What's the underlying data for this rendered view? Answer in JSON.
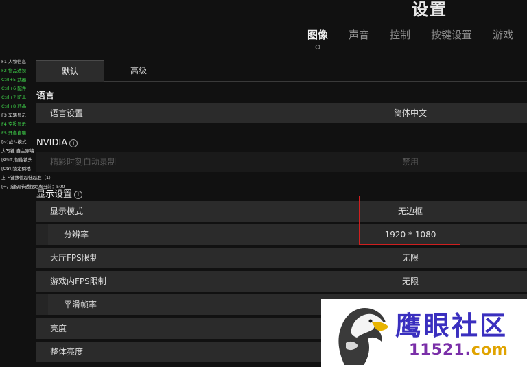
{
  "header": {
    "title": "设置",
    "tabs": [
      {
        "label": "图像",
        "active": true
      },
      {
        "label": "声音",
        "active": false
      },
      {
        "label": "控制",
        "active": false
      },
      {
        "label": "按键设置",
        "active": false
      },
      {
        "label": "游戏",
        "active": false
      }
    ]
  },
  "hotkeys": [
    {
      "text": "F1 人物信息",
      "color": "white"
    },
    {
      "text": "F2 物品透视",
      "color": "green"
    },
    {
      "text": "Ctrl+5 武器",
      "color": "green"
    },
    {
      "text": "Ctrl+6 配件",
      "color": "green"
    },
    {
      "text": "Ctrl+7 防具",
      "color": "green"
    },
    {
      "text": "Ctrl+8 药品",
      "color": "green"
    },
    {
      "text": "F3 车辆显示",
      "color": "white"
    },
    {
      "text": "F4 空投显示",
      "color": "green"
    },
    {
      "text": "F5 开启自瞄",
      "color": "green"
    },
    {
      "text": "[~]战斗模式",
      "color": "white"
    },
    {
      "text": "大写键 自主穿墙",
      "color": "white"
    },
    {
      "text": "[shift]智能锁头",
      "color": "white"
    },
    {
      "text": "[Ctrl]锁定倒地",
      "color": "white"
    },
    {
      "text": "上下键数值越低越准（1）",
      "color": "white"
    },
    {
      "text": "[+/-]键调节透视距离当前：500",
      "color": "white"
    }
  ],
  "subtabs": {
    "default": "默认",
    "advanced": "高级"
  },
  "sections": {
    "language": "语言",
    "nvidia": "NVIDIA",
    "display": "显示设置"
  },
  "rows": {
    "language_setting": {
      "label": "语言设置",
      "value": "简体中文"
    },
    "highlights": {
      "label": "精彩时刻自动录制",
      "value": "禁用"
    },
    "display_mode": {
      "label": "显示模式",
      "value": "无边框"
    },
    "resolution": {
      "label": "分辨率",
      "value": "1920 * 1080"
    },
    "lobby_fps": {
      "label": "大厅FPS限制",
      "value": "无限"
    },
    "ingame_fps": {
      "label": "游戏内FPS限制",
      "value": "无限"
    },
    "smooth_fps": {
      "label": "平滑帧率",
      "value": ""
    },
    "brightness": {
      "label": "亮度",
      "value": ""
    },
    "overall_brightness": {
      "label": "整体亮度",
      "value": ""
    }
  },
  "watermark": {
    "name": "鹰眼社区",
    "url_num": "11521.",
    "url_tld": "com"
  },
  "colors": {
    "highlight_box": "#d01f1f",
    "hotkey_green": "#3fd24a"
  }
}
